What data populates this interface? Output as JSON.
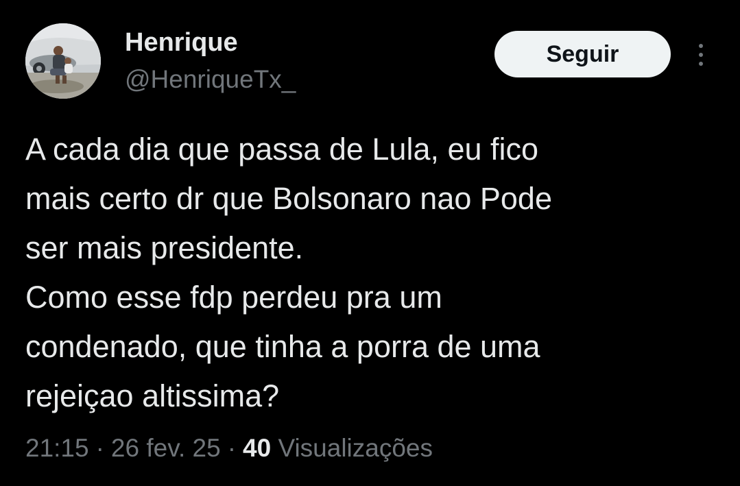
{
  "tweet": {
    "author": {
      "display_name": "Henrique",
      "handle": "@HenriqueTx_",
      "avatar_icon": "profile-photo"
    },
    "follow_label": "Seguir",
    "more_icon": "more-vertical-icon",
    "text_lines": [
      "A cada dia que passa de Lula, eu fico",
      "mais certo dr que Bolsonaro nao Pode",
      "ser mais presidente.",
      "Como esse fdp perdeu pra um",
      "condenado, que tinha a porra de uma",
      "rejeiçao altissima?"
    ],
    "time": "21:15",
    "date": "26 fev. 25",
    "separator": "·",
    "views_count": "40",
    "views_label": "Visualizações"
  },
  "colors": {
    "background": "#000000",
    "primary_text": "#e7e9ea",
    "secondary_text": "#71767b",
    "button_bg": "#eff3f4",
    "button_text": "#0f1419"
  }
}
